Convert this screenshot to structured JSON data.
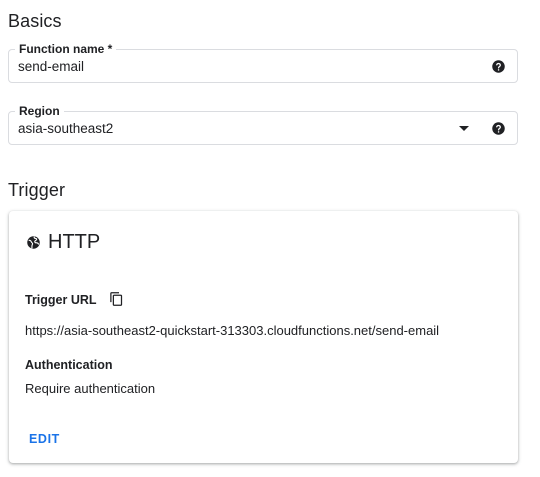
{
  "basics": {
    "title": "Basics",
    "function_name": {
      "label": "Function name *",
      "value": "send-email",
      "help_icon": "help-icon"
    },
    "region": {
      "label": "Region",
      "value": "asia-southeast2",
      "dropdown_icon": "arrow-drop-down-icon",
      "help_icon": "help-icon"
    }
  },
  "trigger": {
    "title": "Trigger",
    "card": {
      "icon": "globe-icon",
      "type": "HTTP",
      "url_label": "Trigger URL",
      "copy_icon": "copy-icon",
      "url": "https://asia-southeast2-quickstart-313303.cloudfunctions.net/send-email",
      "auth_label": "Authentication",
      "auth_value": "Require authentication",
      "edit_label": "EDIT"
    }
  },
  "colors": {
    "accent": "#1a73e8",
    "text": "#202124",
    "border": "#dadce0"
  }
}
